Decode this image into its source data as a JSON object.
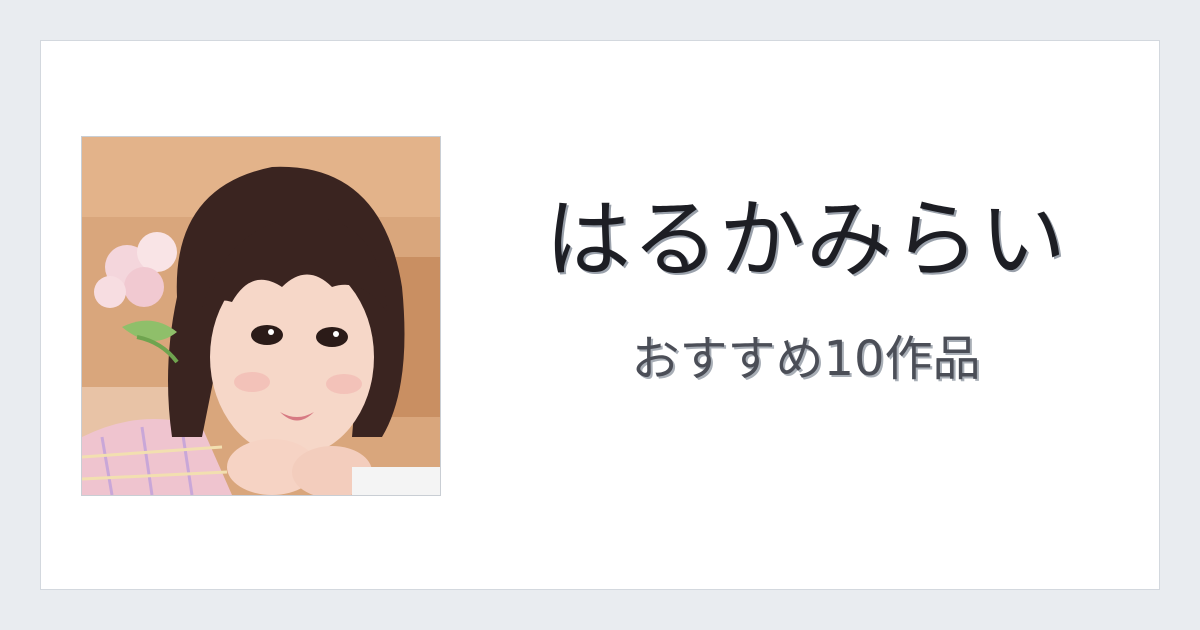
{
  "card": {
    "title": "はるかみらい",
    "subtitle": "おすすめ10作品"
  },
  "photo": {
    "description_icon": "portrait-photo"
  },
  "colors": {
    "page_background": "#e9ecf0",
    "card_background": "#ffffff",
    "title_text": "#1d1e24",
    "subtitle_text": "#4b4e57"
  }
}
